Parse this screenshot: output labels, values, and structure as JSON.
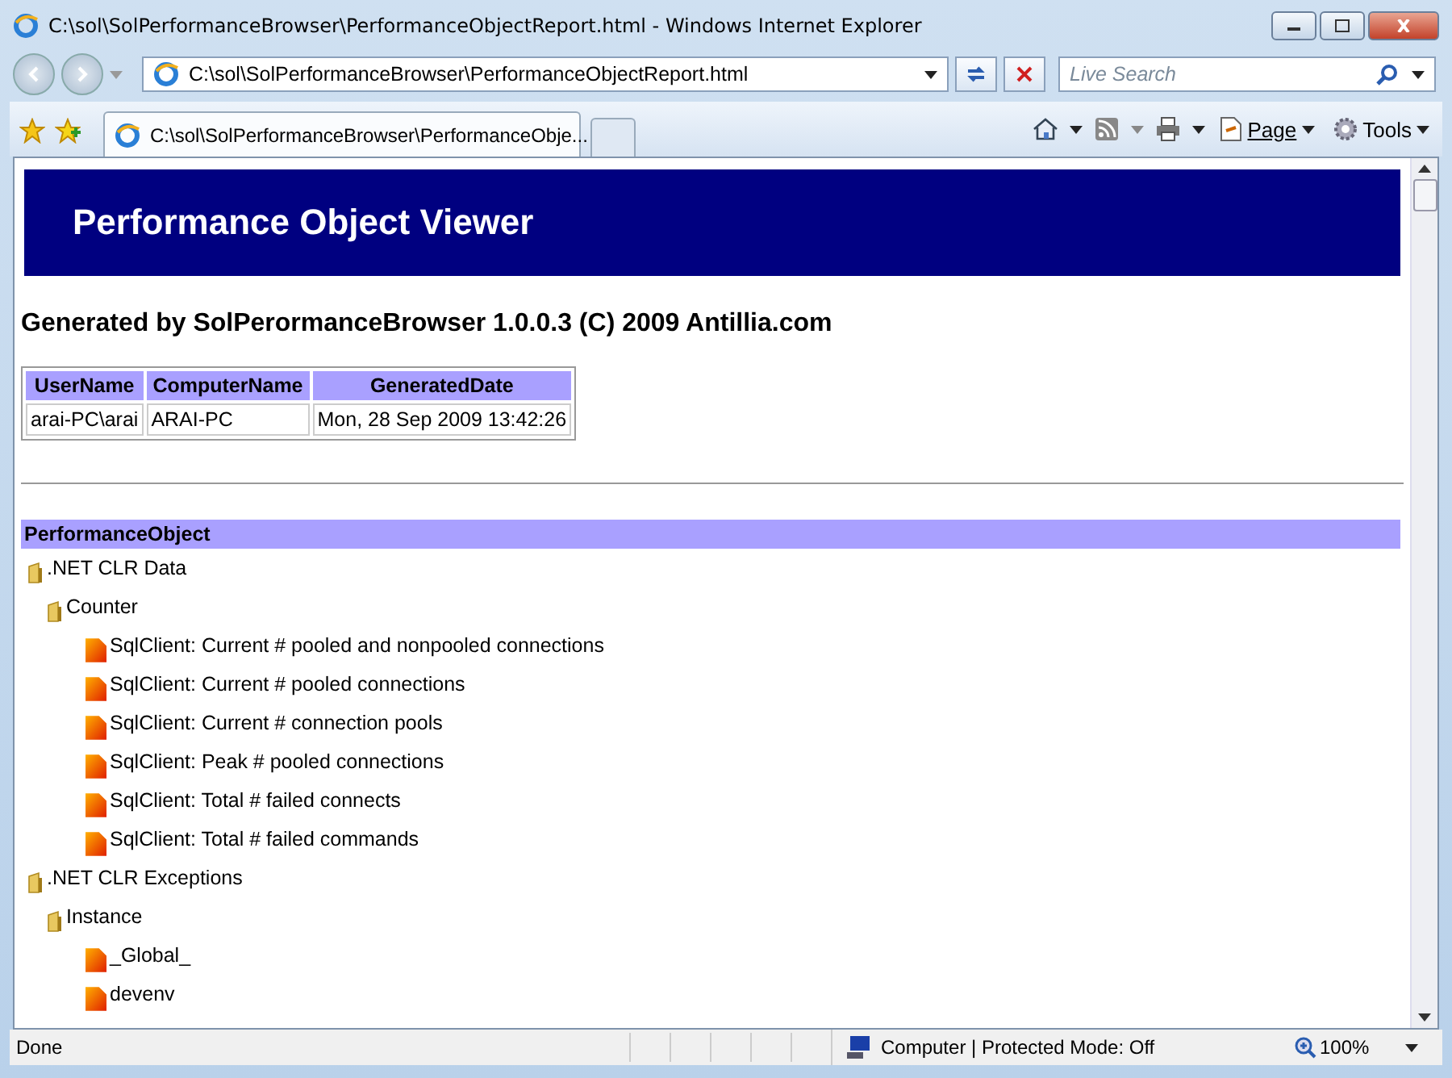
{
  "window": {
    "title": "C:\\sol\\SolPerformanceBrowser\\PerformanceObjectReport.html - Windows Internet Explorer"
  },
  "address_bar": {
    "value": "C:\\sol\\SolPerformanceBrowser\\PerformanceObjectReport.html"
  },
  "search": {
    "placeholder": "Live Search"
  },
  "tabs": [
    {
      "label": "C:\\sol\\SolPerformanceBrowser\\PerformanceObje...",
      "selected": true
    },
    {
      "selected": false
    }
  ],
  "command_bar": {
    "page": "Page",
    "tools": "Tools"
  },
  "page": {
    "banner": "Performance Object Viewer",
    "heading": "Generated by SolPerormanceBrowser 1.0.0.3 (C) 2009 Antillia.com",
    "table": {
      "columns": [
        "UserName",
        "ComputerName",
        "GeneratedDate"
      ],
      "rows": [
        [
          "arai-PC\\arai",
          "ARAI-PC",
          "Mon, 28 Sep 2009 13:42:26"
        ]
      ]
    },
    "section_title": "PerformanceObject",
    "tree": [
      {
        "label": ".NET CLR Data",
        "kind": "folder",
        "children": [
          {
            "label": "Counter",
            "kind": "folder",
            "children": [
              {
                "label": "SqlClient: Current # pooled and nonpooled connections",
                "kind": "item"
              },
              {
                "label": "SqlClient: Current # pooled connections",
                "kind": "item"
              },
              {
                "label": "SqlClient: Current # connection pools",
                "kind": "item"
              },
              {
                "label": "SqlClient: Peak # pooled connections",
                "kind": "item"
              },
              {
                "label": "SqlClient: Total # failed connects",
                "kind": "item"
              },
              {
                "label": "SqlClient: Total # failed commands",
                "kind": "item"
              }
            ]
          }
        ]
      },
      {
        "label": ".NET CLR Exceptions",
        "kind": "folder",
        "children": [
          {
            "label": "Instance",
            "kind": "folder",
            "children": [
              {
                "label": "_Global_",
                "kind": "item"
              },
              {
                "label": "devenv",
                "kind": "item"
              }
            ]
          }
        ]
      }
    ]
  },
  "status_bar": {
    "status": "Done",
    "zone": "Computer | Protected Mode: Off",
    "zoom": "100%"
  }
}
